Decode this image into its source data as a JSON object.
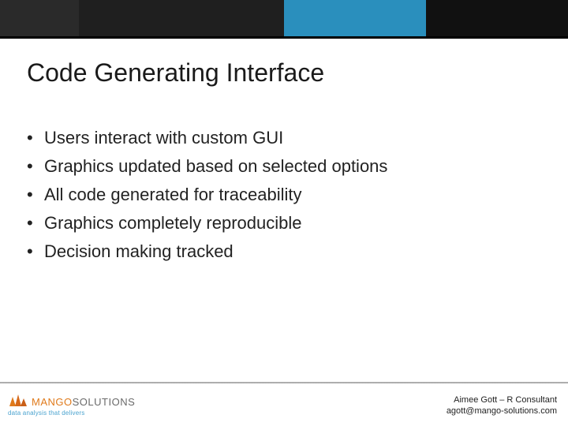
{
  "title": "Code Generating Interface",
  "bullets": [
    "Users interact with custom GUI",
    "Graphics updated based on selected options",
    "All code generated for traceability",
    "Graphics completely reproducible",
    "Decision making tracked"
  ],
  "footer": {
    "logo": {
      "word1": "MANGO",
      "word2": "SOLUTIONS",
      "tagline": "data analysis that delivers"
    },
    "credit_line1": "Aimee Gott – R Consultant",
    "credit_line2": "agott@mango-solutions.com"
  },
  "colors": {
    "accent_blue": "#2a8fbd",
    "accent_orange": "#e07a1b"
  }
}
